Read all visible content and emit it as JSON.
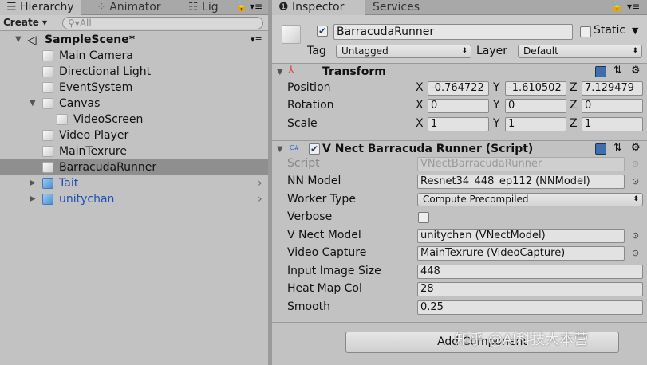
{
  "tabs_left": [
    {
      "label": "Hierarchy",
      "icon": "list-icon"
    },
    {
      "label": "Animator",
      "icon": "animator-icon"
    },
    {
      "label": "Lig",
      "icon": "lighting-icon"
    }
  ],
  "tabs_right": [
    {
      "label": "Inspector",
      "icon": "info-icon"
    },
    {
      "label": "Services"
    }
  ],
  "hierarchy": {
    "create_label": "Create",
    "search_placeholder": "All",
    "scene": "SampleScene*",
    "items": [
      {
        "label": "Main Camera"
      },
      {
        "label": "Directional Light"
      },
      {
        "label": "EventSystem"
      },
      {
        "label": "Canvas"
      },
      {
        "label": "VideoScreen"
      },
      {
        "label": "Video Player"
      },
      {
        "label": "MainTexrure"
      },
      {
        "label": "BarracudaRunner"
      },
      {
        "label": "Tait"
      },
      {
        "label": "unitychan"
      }
    ]
  },
  "inspector": {
    "object_name": "BarracudaRunner",
    "active": true,
    "static_label": "Static",
    "tag_label": "Tag",
    "tag_value": "Untagged",
    "layer_label": "Layer",
    "layer_value": "Default",
    "transform": {
      "title": "Transform",
      "rows": [
        {
          "label": "Position",
          "x": "-0.764722",
          "y": "-1.610502",
          "z": "7.129479"
        },
        {
          "label": "Rotation",
          "x": "0",
          "y": "0",
          "z": "0"
        },
        {
          "label": "Scale",
          "x": "1",
          "y": "1",
          "z": "1"
        }
      ],
      "axes": [
        "X",
        "Y",
        "Z"
      ]
    },
    "script": {
      "title": "V Nect Barracuda Runner (Script)",
      "script_label": "Script",
      "script_value": "VNectBarracudaRunner",
      "nn_label": "NN Model",
      "nn_value": "Resnet34_448_ep112 (NNModel)",
      "worker_label": "Worker Type",
      "worker_value": "Compute Precompiled",
      "verbose_label": "Verbose",
      "verbose": false,
      "vnect_label": "V Nect Model",
      "vnect_value": "unitychan (VNectModel)",
      "video_label": "Video Capture",
      "video_value": "MainTexrure (VideoCapture)",
      "input_label": "Input Image Size",
      "input_value": "448",
      "heat_label": "Heat Map Col",
      "heat_value": "28",
      "smooth_label": "Smooth",
      "smooth_value": "0.25"
    },
    "add_component": "Add Component"
  },
  "watermark": "知乎 @AI科技大本营"
}
